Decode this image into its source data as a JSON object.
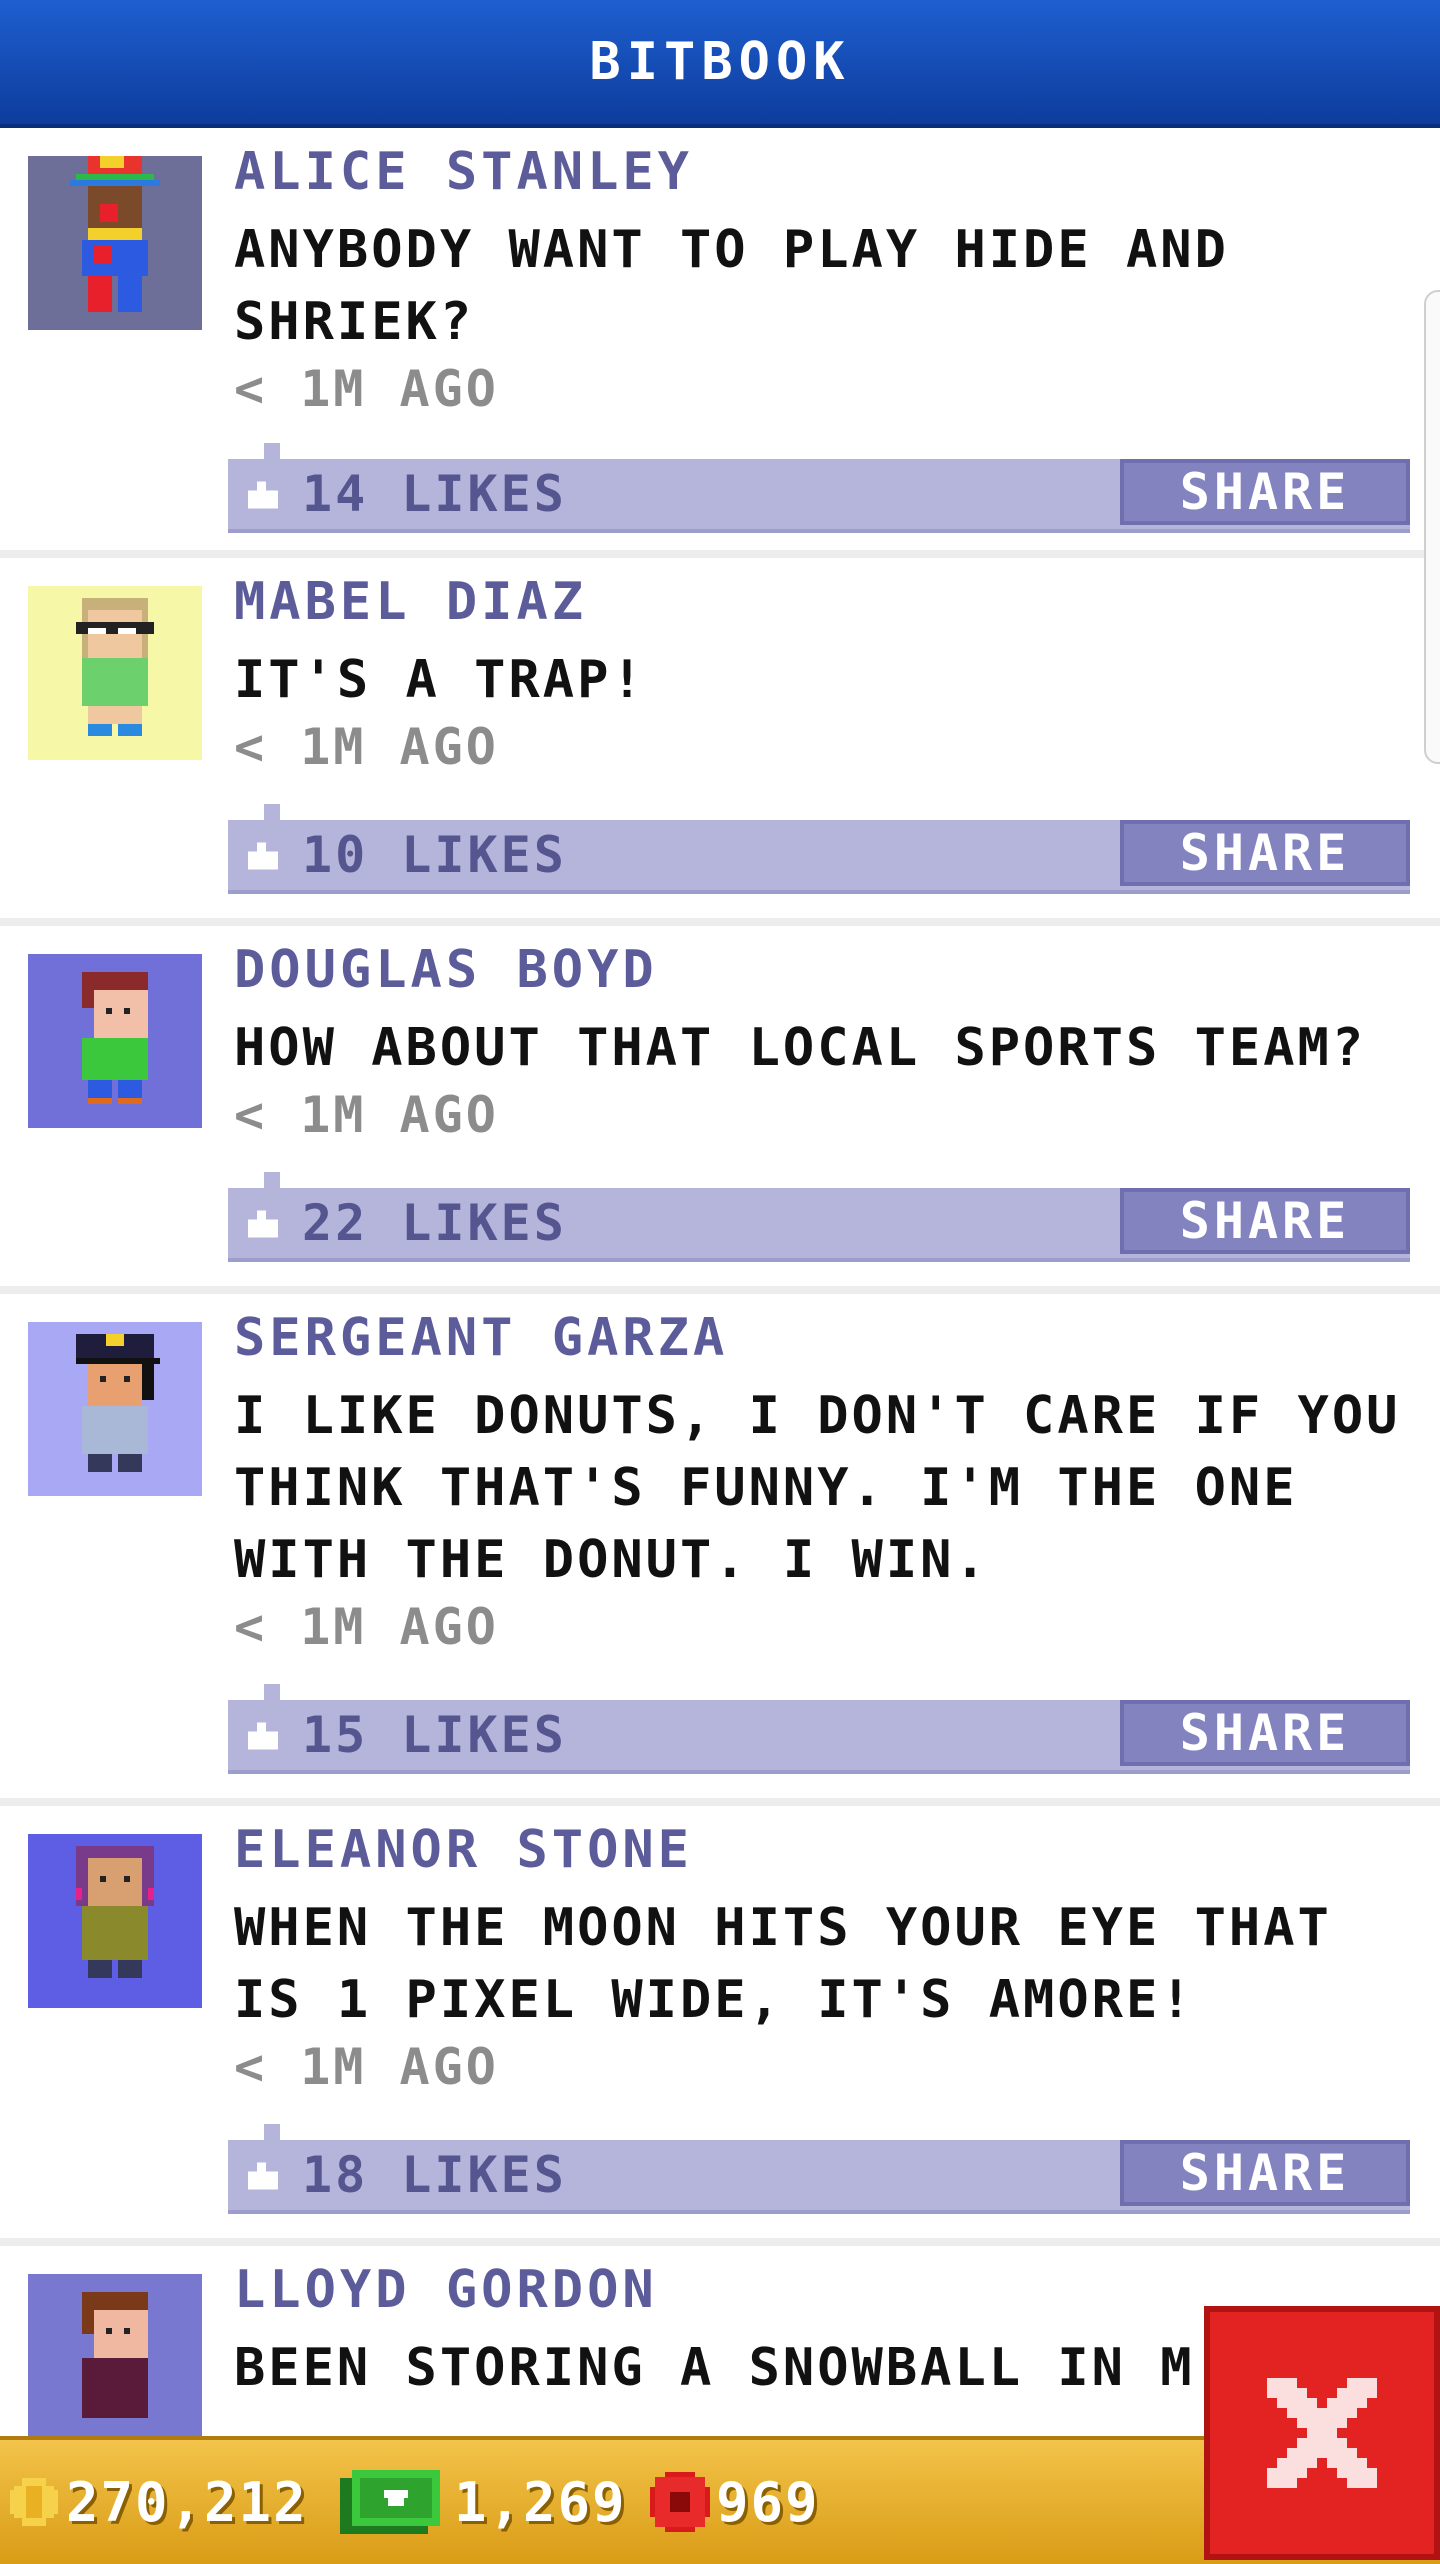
{
  "header": {
    "title": "BITBOOK"
  },
  "posts": [
    {
      "name": "Alice Stanley",
      "message": "Anybody want to play hide and shriek?",
      "time": "< 1M AGO",
      "likes": "14 LIKES",
      "share": "SHARE",
      "avatar_bg": "#6d6f98"
    },
    {
      "name": "Mabel Diaz",
      "message": "It's a trap!",
      "time": "< 1M AGO",
      "likes": "10 LIKES",
      "share": "SHARE",
      "avatar_bg": "#f7f7a8"
    },
    {
      "name": "Douglas Boyd",
      "message": "How about that local sports team?",
      "time": "< 1M AGO",
      "likes": "22 LIKES",
      "share": "SHARE",
      "avatar_bg": "#7070d8"
    },
    {
      "name": "Sergeant Garza",
      "message": "I like donuts, I don't care if you think that's funny. I'm the one with the donut. I win.",
      "time": "< 1M AGO",
      "likes": "15 LIKES",
      "share": "SHARE",
      "avatar_bg": "#a8a8f4"
    },
    {
      "name": "Eleanor Stone",
      "message": "When the moon hits your eye that is 1 pixel wide, it's amore!",
      "time": "< 1M AGO",
      "likes": "18 LIKES",
      "share": "SHARE",
      "avatar_bg": "#5e5ee4"
    },
    {
      "name": "Lloyd Gordon",
      "message": "Been storing a snowball in m",
      "time": "",
      "likes": "",
      "share": "",
      "avatar_bg": "#7878d0"
    }
  ],
  "status": {
    "coins": "270,212",
    "bux": "1,269",
    "gems": "969"
  },
  "colors": {
    "header": "#1a56c4",
    "accent": "#b5b5db",
    "share": "#8383c0",
    "bottom_bar": "#e8b232",
    "close": "#e32222"
  },
  "icons": {
    "like": "thumb-up-icon",
    "coin": "coin-icon",
    "bux": "bux-icon",
    "gem": "gem-icon",
    "close": "close-icon"
  }
}
